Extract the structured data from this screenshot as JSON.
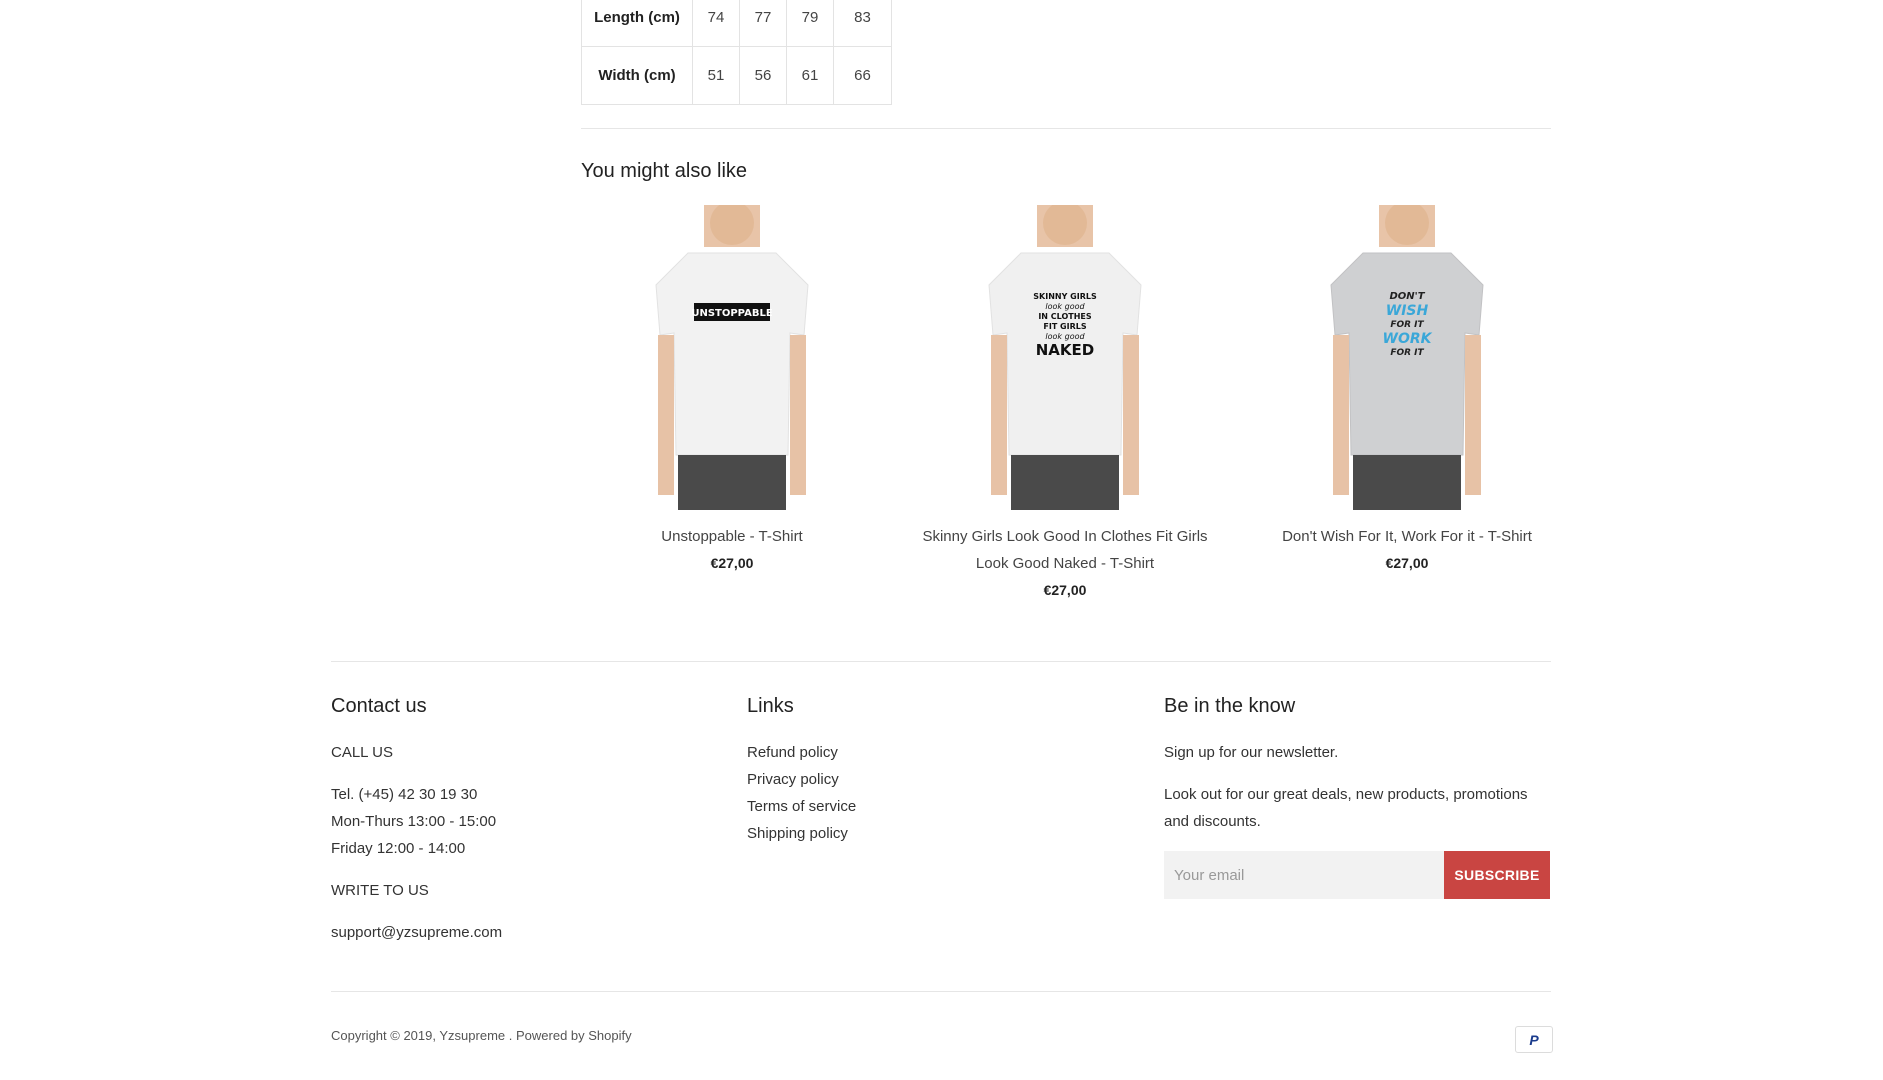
{
  "size_table": {
    "rows": [
      {
        "label": "Length (cm)",
        "values": [
          "74",
          "77",
          "79",
          "83"
        ]
      },
      {
        "label": "Width (cm)",
        "values": [
          "51",
          "56",
          "61",
          "66"
        ]
      }
    ]
  },
  "related": {
    "title": "You might also like",
    "products": [
      {
        "name": "Unstoppable - T-Shirt",
        "price": "€27,00",
        "shirt_color": "#f2f2f2",
        "print": "UNSTOPPABLE"
      },
      {
        "name": "Skinny Girls Look Good In Clothes Fit Girls Look Good Naked - T-Shirt",
        "price": "€27,00",
        "shirt_color": "#f0f0f0",
        "print": "SKINNY GIRLS"
      },
      {
        "name": "Don't Wish For It, Work For it - T-Shirt",
        "price": "€27,00",
        "shirt_color": "#cfd0d2",
        "print": "DON'T WISH"
      }
    ]
  },
  "footer": {
    "contact": {
      "title": "Contact us",
      "call_label": "CALL US",
      "phone": "Tel. (+45) 42 30 19 30",
      "hours1": "Mon-Thurs 13:00 - 15:00",
      "hours2": "Friday 12:00 - 14:00",
      "write_label": "WRITE TO US",
      "email": "support@yzsupreme.com"
    },
    "links": {
      "title": "Links",
      "items": [
        "Refund policy",
        "Privacy policy",
        "Terms of service",
        "Shipping policy"
      ]
    },
    "newsletter": {
      "title": "Be in the know",
      "line1": "Sign up for our newsletter.",
      "line2": "Look out for our great deals, new products, promotions and discounts.",
      "placeholder": "Your email",
      "button": "SUBSCRIBE"
    },
    "copyright_prefix": "Copyright © 2019,",
    "brand": "Yzsupreme",
    "powered": "Powered by Shopify",
    "payment_icon": "paypal-icon",
    "payment_label": "P"
  },
  "colors": {
    "accent": "#c94542",
    "divider": "#e6e6e6"
  }
}
